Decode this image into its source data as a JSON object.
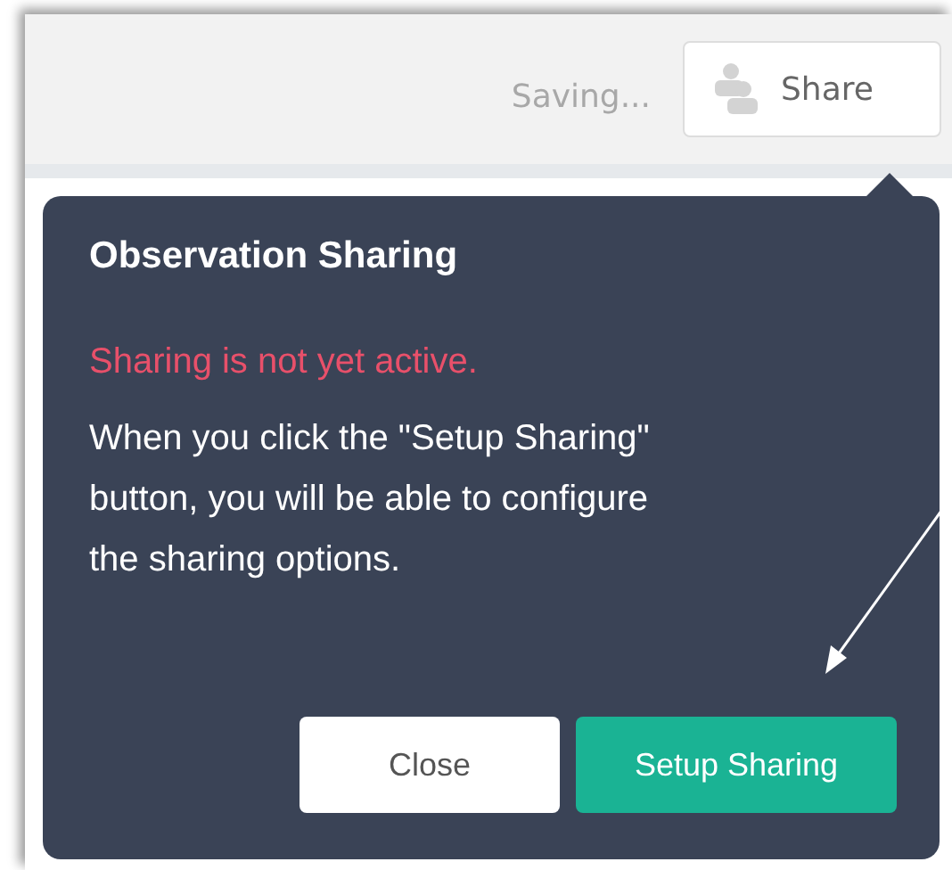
{
  "header": {
    "status": "Saving...",
    "share_button": "Share"
  },
  "popover": {
    "title": "Observation Sharing",
    "warning": "Sharing is not yet active.",
    "message": "When you click the \"Setup Sharing\" button, you will be able to configure the sharing options.",
    "buttons": [
      {
        "label": "Close",
        "kind": "secondary"
      },
      {
        "label": "Setup Sharing",
        "kind": "primary"
      }
    ]
  }
}
